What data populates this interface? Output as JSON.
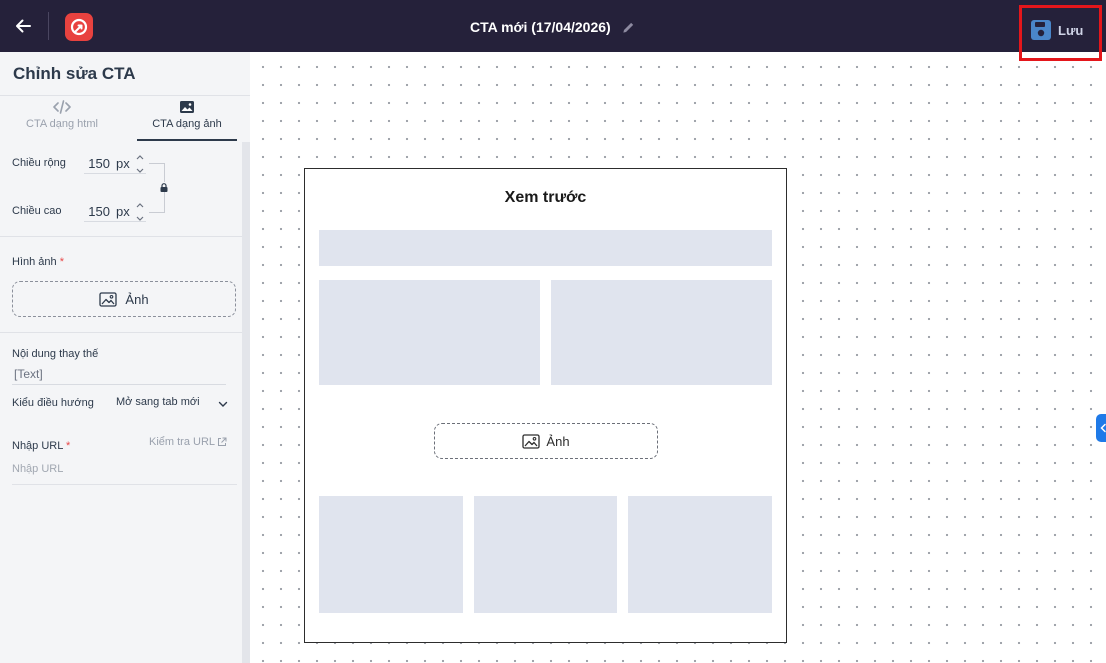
{
  "header": {
    "title": "CTA mới (17/04/2026)",
    "save_label": "Lưu"
  },
  "panel": {
    "title": "Chỉnh sửa CTA",
    "tabs": [
      {
        "label": "CTA dạng html",
        "active": false
      },
      {
        "label": "CTA dạng ảnh",
        "active": true
      }
    ],
    "width": {
      "label": "Chiều rộng",
      "value": "150",
      "unit": "px"
    },
    "height": {
      "label": "Chiều cao",
      "value": "150",
      "unit": "px"
    },
    "image": {
      "label": "Hình ảnh",
      "required_mark": "*",
      "button_label": "Ảnh"
    },
    "alt_text": {
      "label": "Nội dung thay thế",
      "value": "[Text]"
    },
    "navigation": {
      "label": "Kiểu điều hướng",
      "value": "Mở sang tab mới"
    },
    "url": {
      "label": "Nhập URL",
      "required_mark": "*",
      "check_label": "Kiểm tra URL",
      "placeholder": "Nhập URL"
    }
  },
  "preview": {
    "title": "Xem trước",
    "button_label": "Ảnh"
  },
  "colors": {
    "topbar": "#25213a",
    "brand": "#e8423f",
    "save_icon": "#4a86c9",
    "highlight": "#e4161b",
    "skeleton": "#e0e4ee",
    "toggle": "#1f7ae8"
  }
}
